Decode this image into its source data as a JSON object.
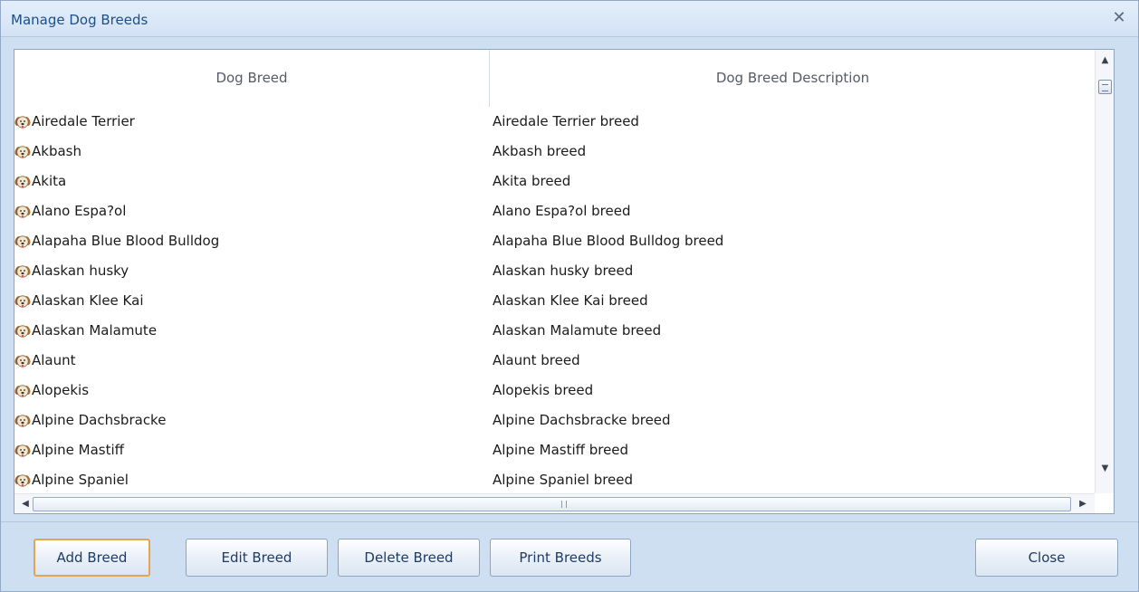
{
  "window": {
    "title": "Manage Dog Breeds",
    "close_glyph": "✕"
  },
  "grid": {
    "columns": [
      "Dog Breed",
      "Dog Breed Description"
    ],
    "row_icon": "dog-breed-icon",
    "rows": [
      {
        "breed": "Airedale Terrier",
        "description": "Airedale Terrier breed"
      },
      {
        "breed": "Akbash",
        "description": "Akbash breed"
      },
      {
        "breed": "Akita",
        "description": "Akita breed"
      },
      {
        "breed": "Alano Espa?ol",
        "description": "Alano Espa?ol breed"
      },
      {
        "breed": "Alapaha Blue Blood Bulldog",
        "description": "Alapaha Blue Blood Bulldog breed"
      },
      {
        "breed": "Alaskan husky",
        "description": "Alaskan husky breed"
      },
      {
        "breed": "Alaskan Klee Kai",
        "description": "Alaskan Klee Kai breed"
      },
      {
        "breed": "Alaskan Malamute",
        "description": "Alaskan Malamute breed"
      },
      {
        "breed": "Alaunt",
        "description": "Alaunt breed"
      },
      {
        "breed": "Alopekis",
        "description": "Alopekis breed"
      },
      {
        "breed": "Alpine Dachsbracke",
        "description": "Alpine Dachsbracke breed"
      },
      {
        "breed": "Alpine Mastiff",
        "description": "Alpine Mastiff breed"
      },
      {
        "breed": "Alpine Spaniel",
        "description": "Alpine Spaniel breed"
      }
    ]
  },
  "scrollbars": {
    "up": "▲",
    "down": "▼",
    "left": "◀",
    "right": "▶"
  },
  "buttons": {
    "add": "Add Breed",
    "edit": "Edit Breed",
    "delete": "Delete Breed",
    "print": "Print Breeds",
    "close": "Close"
  },
  "colors": {
    "title_text": "#1a4f8a",
    "frame": "#cfdff2",
    "default_button_border": "#e4a552"
  }
}
